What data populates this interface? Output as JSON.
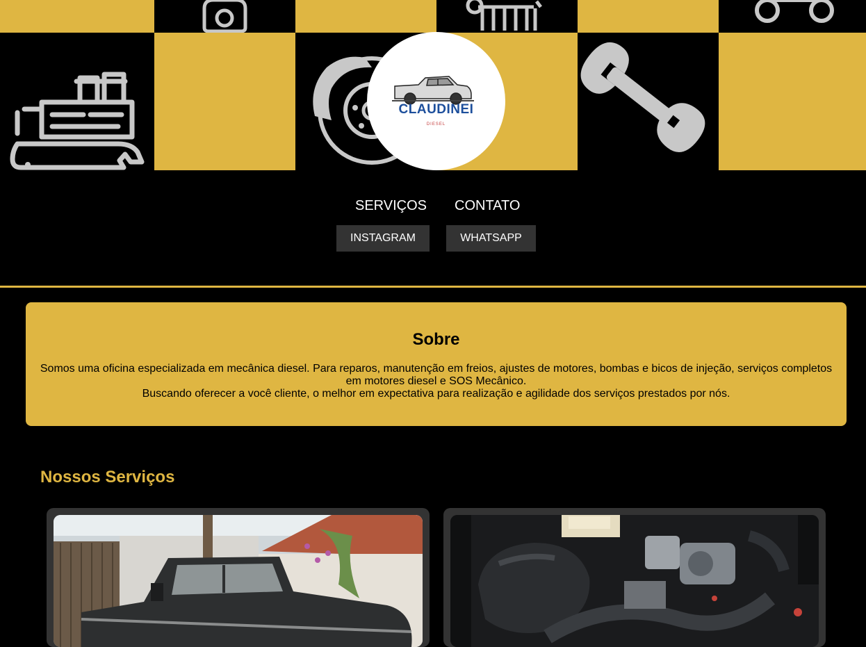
{
  "colors": {
    "gold": "#dfb642",
    "dark": "#000000",
    "button_bg": "#333333",
    "brand_blue": "#1d4f9c"
  },
  "hero": {
    "tiles": [
      {
        "icon": "engine-block-icon"
      },
      {
        "icon": "gear-mount-icon"
      },
      {
        "icon": "cylinder-head-icon"
      },
      {
        "icon": "sprocket-icon"
      },
      {
        "icon": "engine-wrench-icon"
      },
      {
        "icon": "brake-disc-icon"
      },
      {
        "icon": "wrench-icon"
      }
    ],
    "logo": {
      "brand": "CLAUDINEI",
      "sub": "DIESEL",
      "icon": "pickup-truck-icon"
    }
  },
  "nav": {
    "services": "SERVIÇOS",
    "contact": "CONTATO"
  },
  "social": {
    "instagram": "INSTAGRAM",
    "whatsapp": "WHATSAPP"
  },
  "about": {
    "title": "Sobre",
    "line1": "Somos uma oficina especializada em mecânica diesel. Para reparos, manutenção em freios, ajustes de motores, bombas e bicos de injeção, serviços completos em motores diesel e SOS Mecânico.",
    "line2": "Buscando oferecer a você cliente, o melhor em expectativa para realização e agilidade dos serviços prestados por nós."
  },
  "services": {
    "title": "Nossos Serviços",
    "cards": [
      {
        "image": "classic-pickup-photo"
      },
      {
        "image": "diesel-engine-photo"
      }
    ]
  }
}
